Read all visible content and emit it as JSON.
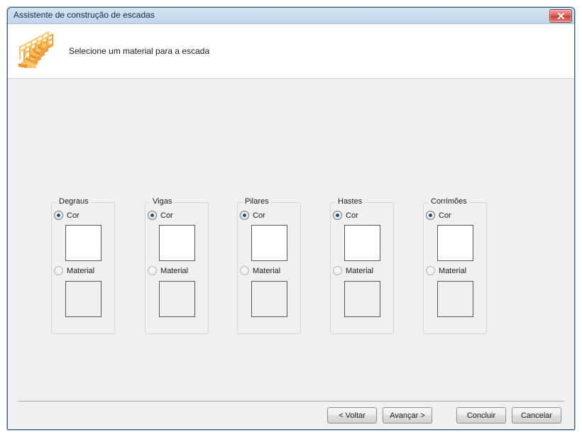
{
  "window": {
    "title": "Assistente de construção de escadas",
    "close_icon": "close-icon",
    "accent_title_bar": "#cbdced",
    "accent_close": "#c93c35",
    "body_bg": "#f0f0f0",
    "header_bg": "#ffffff"
  },
  "header": {
    "icon": "staircase-icon",
    "title": "Selecione um material para a escada"
  },
  "groups": [
    {
      "label": "Degraus",
      "options": [
        {
          "label": "Cor",
          "selected": true
        },
        {
          "label": "Material",
          "selected": false
        }
      ],
      "color_swatch": "#ffffff",
      "material_swatch": "#f0f0f0"
    },
    {
      "label": "Vigas",
      "options": [
        {
          "label": "Cor",
          "selected": true
        },
        {
          "label": "Material",
          "selected": false
        }
      ],
      "color_swatch": "#ffffff",
      "material_swatch": "#f0f0f0"
    },
    {
      "label": "Pilares",
      "options": [
        {
          "label": "Cor",
          "selected": true
        },
        {
          "label": "Material",
          "selected": false
        }
      ],
      "color_swatch": "#ffffff",
      "material_swatch": "#f0f0f0"
    },
    {
      "label": "Hastes",
      "options": [
        {
          "label": "Cor",
          "selected": true
        },
        {
          "label": "Material",
          "selected": false
        }
      ],
      "color_swatch": "#ffffff",
      "material_swatch": "#f0f0f0"
    },
    {
      "label": "Corrimões",
      "options": [
        {
          "label": "Cor",
          "selected": true
        },
        {
          "label": "Material",
          "selected": false
        }
      ],
      "color_swatch": "#ffffff",
      "material_swatch": "#f0f0f0"
    }
  ],
  "footer": {
    "back_label": "< Voltar",
    "next_label": "Avançar >",
    "finish_label": "Concluir",
    "cancel_label": "Cancelar"
  }
}
